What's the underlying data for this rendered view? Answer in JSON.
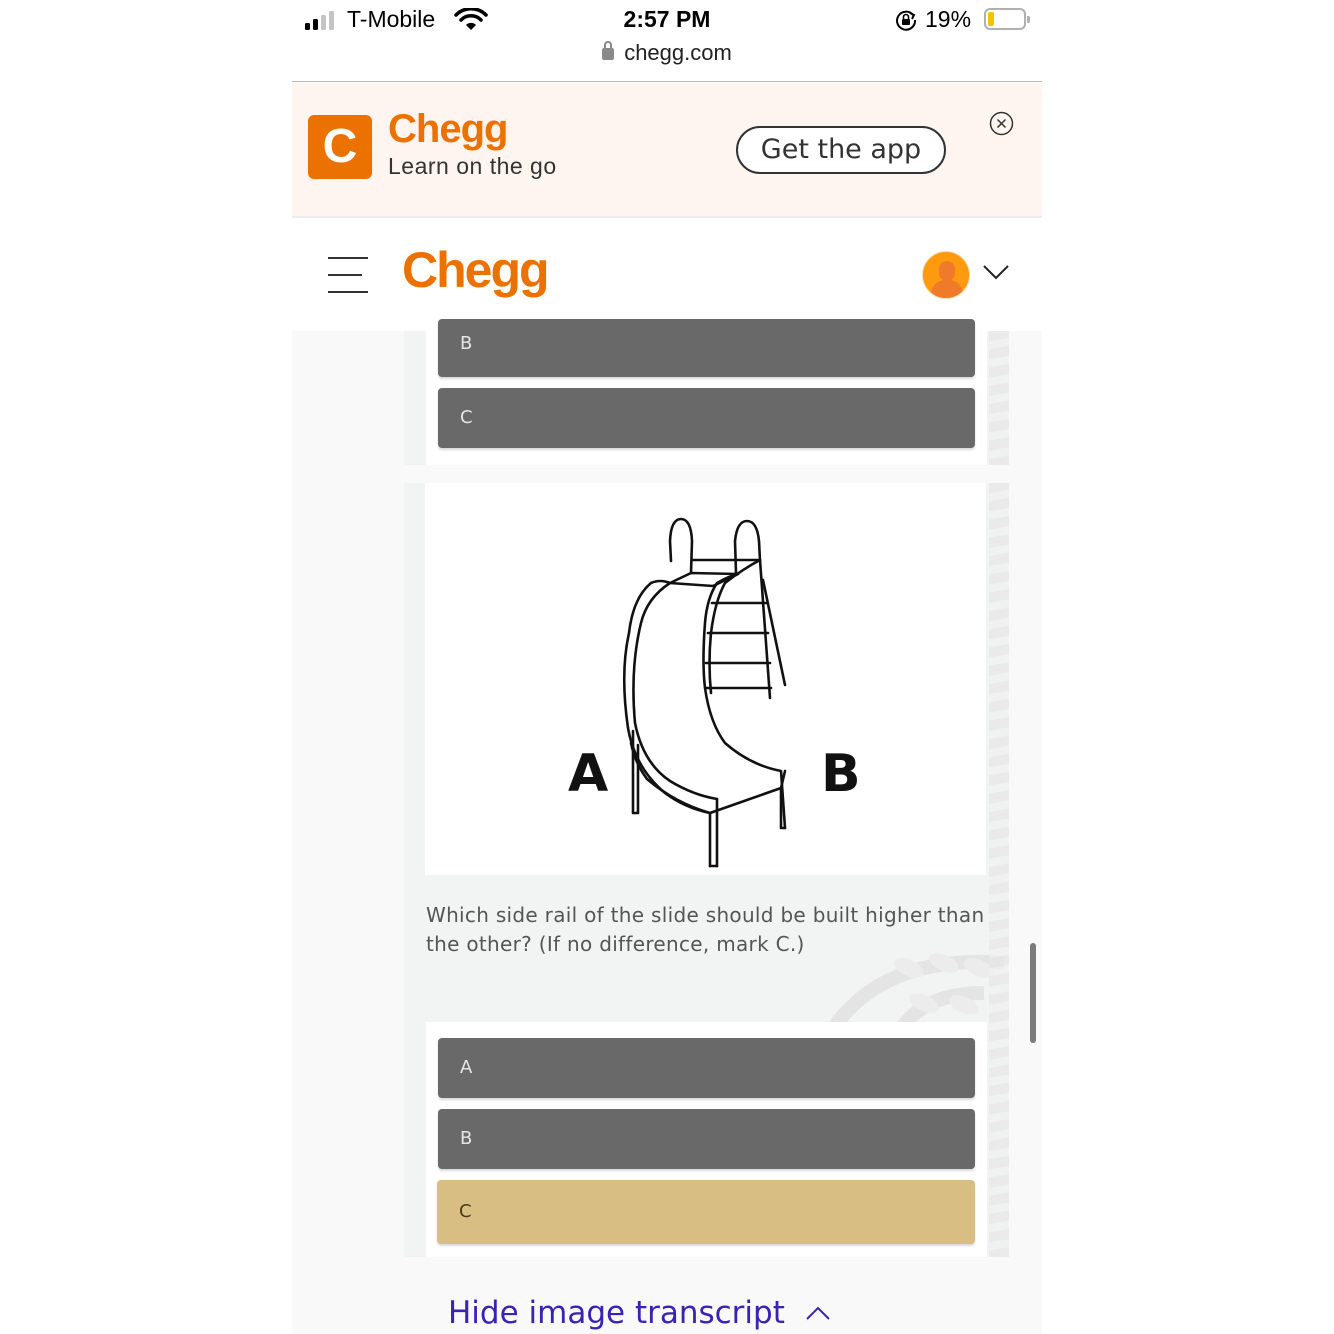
{
  "status_bar": {
    "carrier": "T-Mobile",
    "signal_bars_active": 2,
    "signal_bars_total": 4,
    "time": "2:57 PM",
    "url": "chegg.com",
    "battery_percent_label": "19%",
    "battery_level": 0.19,
    "icons": [
      "signal-icon",
      "wifi-icon",
      "lock-icon",
      "rotation-lock-icon",
      "battery-icon"
    ]
  },
  "app_banner": {
    "logo_letter": "C",
    "brand": "Chegg",
    "tagline": "Learn on the go",
    "cta_label": "Get the app",
    "close_icon": "close-circle-icon"
  },
  "nav": {
    "menu_icon": "hamburger-icon",
    "logo": "Chegg",
    "avatar_icon": "user-avatar-icon",
    "dropdown_icon": "chevron-down-icon"
  },
  "previous_question": {
    "options": [
      {
        "label": "B",
        "selected": false
      },
      {
        "label": "C",
        "selected": false
      }
    ]
  },
  "question": {
    "figure": {
      "label_left": "A",
      "label_right": "B",
      "description": "curved slide with ladder"
    },
    "text": "Which side rail of the slide should be built higher than the other? (If no difference, mark C.)",
    "options": [
      {
        "label": "A",
        "selected": false
      },
      {
        "label": "B",
        "selected": false
      },
      {
        "label": "C",
        "selected": true
      }
    ]
  },
  "footer": {
    "transcript_toggle_label": "Hide image transcript",
    "transcript_toggle_icon": "chevron-up-icon"
  },
  "colors": {
    "brand_orange": "#eb7100",
    "option_default": "#696969",
    "option_selected": "#d8be82",
    "link_purple": "#3b22b5",
    "banner_bg": "#fff5f0"
  }
}
